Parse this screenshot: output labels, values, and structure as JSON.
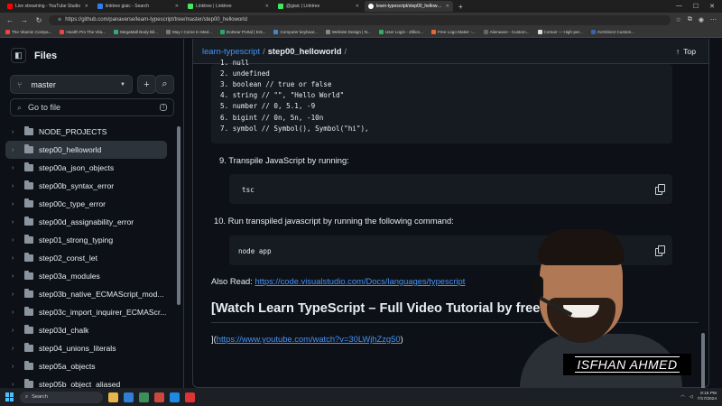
{
  "browser": {
    "tabs": [
      {
        "label": "Live streaming - YouTube Studio",
        "color": "#ff0000",
        "active": false
      },
      {
        "label": "linktree giaic - Search",
        "color": "#2f80ed",
        "active": false
      },
      {
        "label": "Linktree | Linktree",
        "color": "#43e660",
        "active": false
      },
      {
        "label": "@giaic | Linktree",
        "color": "#43e660",
        "active": false
      },
      {
        "label": "learn-typescript/step00_hellowo...",
        "color": "#ffffff",
        "active": true
      }
    ],
    "new_tab": "+",
    "url": "https://github.com/panaverse/learn-typescript/tree/master/step00_helloworld",
    "bookmarks": [
      {
        "label": "The Vitamin Compa...",
        "color": "#e44"
      },
      {
        "label": "Health Pro The Vita...",
        "color": "#e44"
      },
      {
        "label": "MegaMall Body Bil...",
        "color": "#3a7"
      },
      {
        "label": "May I Come In Med...",
        "color": "#777"
      },
      {
        "label": "DoDear Portal | Ent...",
        "color": "#2a6"
      },
      {
        "label": "Computer keyboar...",
        "color": "#48c"
      },
      {
        "label": "Website Design | N...",
        "color": "#888"
      },
      {
        "label": "User Login - Zillion...",
        "color": "#3a6"
      },
      {
        "label": "Free Logo Maker -...",
        "color": "#e63"
      },
      {
        "label": "Alienware - Custom...",
        "color": "#666"
      },
      {
        "label": "Corsair — High-per...",
        "color": "#ddd"
      },
      {
        "label": "AVADirect Custom...",
        "color": "#36a"
      }
    ]
  },
  "sidebar": {
    "title": "Files",
    "branch": "master",
    "goto_label": "Go to file",
    "goto_key": "t",
    "items": [
      {
        "label": "NODE_PROJECTS",
        "selected": false
      },
      {
        "label": "step00_helloworld",
        "selected": true
      },
      {
        "label": "step00a_json_objects",
        "selected": false
      },
      {
        "label": "step00b_syntax_error",
        "selected": false
      },
      {
        "label": "step00c_type_error",
        "selected": false
      },
      {
        "label": "step00d_assignability_error",
        "selected": false
      },
      {
        "label": "step01_strong_typing",
        "selected": false
      },
      {
        "label": "step02_const_let",
        "selected": false
      },
      {
        "label": "step03a_modules",
        "selected": false
      },
      {
        "label": "step03b_native_ECMAScript_mod...",
        "selected": false
      },
      {
        "label": "step03c_import_inquirer_ECMAScr...",
        "selected": false
      },
      {
        "label": "step03d_chalk",
        "selected": false
      },
      {
        "label": "step04_unions_literals",
        "selected": false
      },
      {
        "label": "step05a_objects",
        "selected": false
      },
      {
        "label": "step05b_object_aliased",
        "selected": false
      }
    ]
  },
  "main": {
    "breadcrumb_repo": "learn-typescript",
    "breadcrumb_sep": "/",
    "breadcrumb_dir": "step00_helloworld",
    "breadcrumb_trail": "/",
    "top_label": "Top",
    "type_list": [
      "1. null",
      "2. undefined",
      "3. boolean // true or false",
      "4. string // \"\", \"Hello World\"",
      "5. number // 0, 5.1, -9",
      "6. bigint // 0n, 5n, -10n",
      "7. symbol // Symbol(), Symbol(\"hi\"),"
    ],
    "step9": "9. Transpile JavaScript by running:",
    "step9_code": "tsc",
    "step10": "10. Run transpiled javascript by running the following command:",
    "step10_code": "node app",
    "also_read_label": "Also Read: ",
    "also_read_link": "https://code.visualstudio.com/Docs/languages/typescript",
    "heading": "[Watch Learn TypeScript – Full Video Tutorial by freeCod",
    "video_prefix": "](",
    "video_link": "https://www.youtube.com/watch?v=30LWjhZzg50",
    "video_suffix": ")"
  },
  "overlay": {
    "name": "ISFHAN AHMED"
  },
  "taskbar": {
    "search": "Search",
    "time": "8:16 PM",
    "date": "7/17/2024"
  }
}
